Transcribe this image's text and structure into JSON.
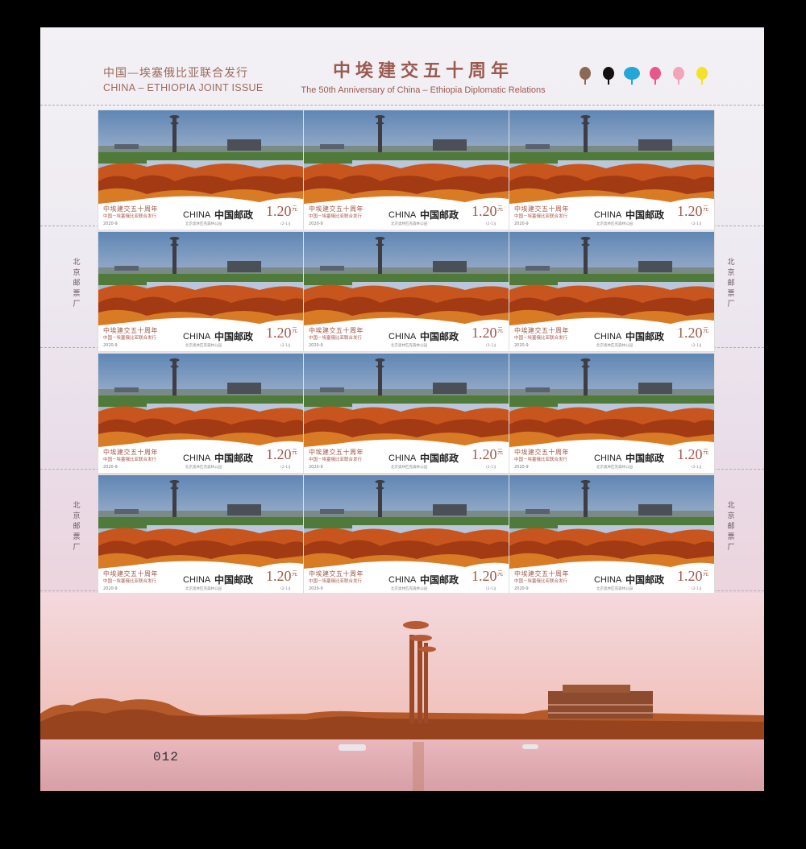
{
  "header": {
    "left_zh": "中国—埃塞俄比亚联合发行",
    "left_en": "CHINA – ETHIOPIA JOINT ISSUE",
    "title_zh": "中埃建交五十周年",
    "title_en": "The 50th Anniversary of China – Ethiopia Diplomatic Relations"
  },
  "color_marks": [
    "#8a6a55",
    "#111111",
    "#23a7d9",
    "#e8568c",
    "#f2a4b8",
    "#f2e22a"
  ],
  "side_marks": {
    "text": "北京邮票厂"
  },
  "stamp": {
    "title_zh": "中埃建交五十周年",
    "subtitle": "中国－埃塞俄比亚联合发行",
    "year": "2020-9",
    "country": "CHINA",
    "post": "中国邮政",
    "value": "1.20",
    "unit": "元",
    "caption": "北京奥林匹克森林公园",
    "number": "(2-1)J"
  },
  "serial": "012"
}
